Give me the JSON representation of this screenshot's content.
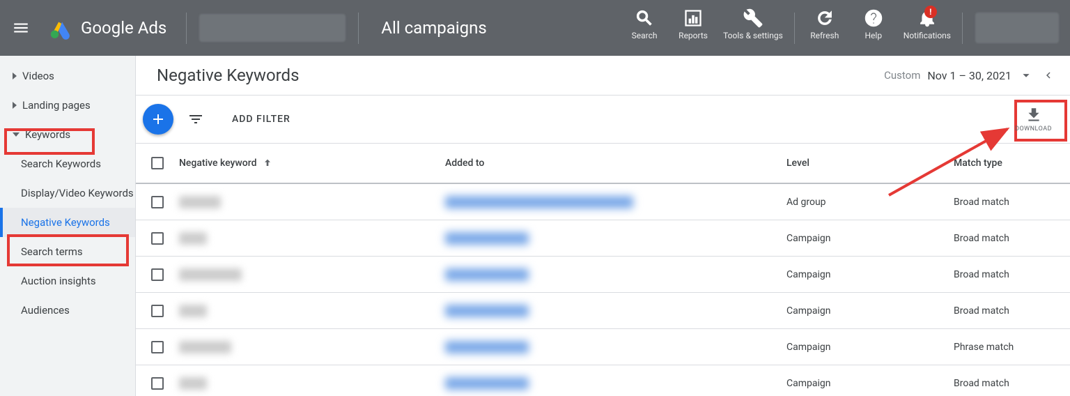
{
  "header": {
    "brand": "Google Ads",
    "scope": "All campaigns",
    "tools": {
      "search": "Search",
      "reports": "Reports",
      "tools": "Tools & settings",
      "refresh": "Refresh",
      "help": "Help",
      "notifications": "Notifications",
      "notif_badge": "!"
    }
  },
  "sidebar": {
    "videos": "Videos",
    "landing": "Landing pages",
    "keywords": "Keywords",
    "search_keywords": "Search Keywords",
    "display_video": "Display/Video Keywords",
    "negative": "Negative Keywords",
    "search_terms": "Search terms",
    "auction": "Auction insights",
    "audiences": "Audiences"
  },
  "page": {
    "title": "Negative Keywords",
    "date_label": "Custom",
    "date_value": "Nov 1 – 30, 2021",
    "add_filter": "ADD FILTER",
    "download": "DOWNLOAD"
  },
  "table": {
    "headers": {
      "keyword": "Negative keyword",
      "added_to": "Added to",
      "level": "Level",
      "match_type": "Match type"
    },
    "rows": [
      {
        "kw_w": 60,
        "added_w": 270,
        "level": "Ad group",
        "match": "Broad match"
      },
      {
        "kw_w": 40,
        "added_w": 120,
        "level": "Campaign",
        "match": "Broad match"
      },
      {
        "kw_w": 90,
        "added_w": 120,
        "level": "Campaign",
        "match": "Broad match"
      },
      {
        "kw_w": 40,
        "added_w": 120,
        "level": "Campaign",
        "match": "Broad match"
      },
      {
        "kw_w": 75,
        "added_w": 120,
        "level": "Campaign",
        "match": "Phrase match"
      },
      {
        "kw_w": 40,
        "added_w": 120,
        "level": "Campaign",
        "match": "Broad match"
      }
    ]
  }
}
